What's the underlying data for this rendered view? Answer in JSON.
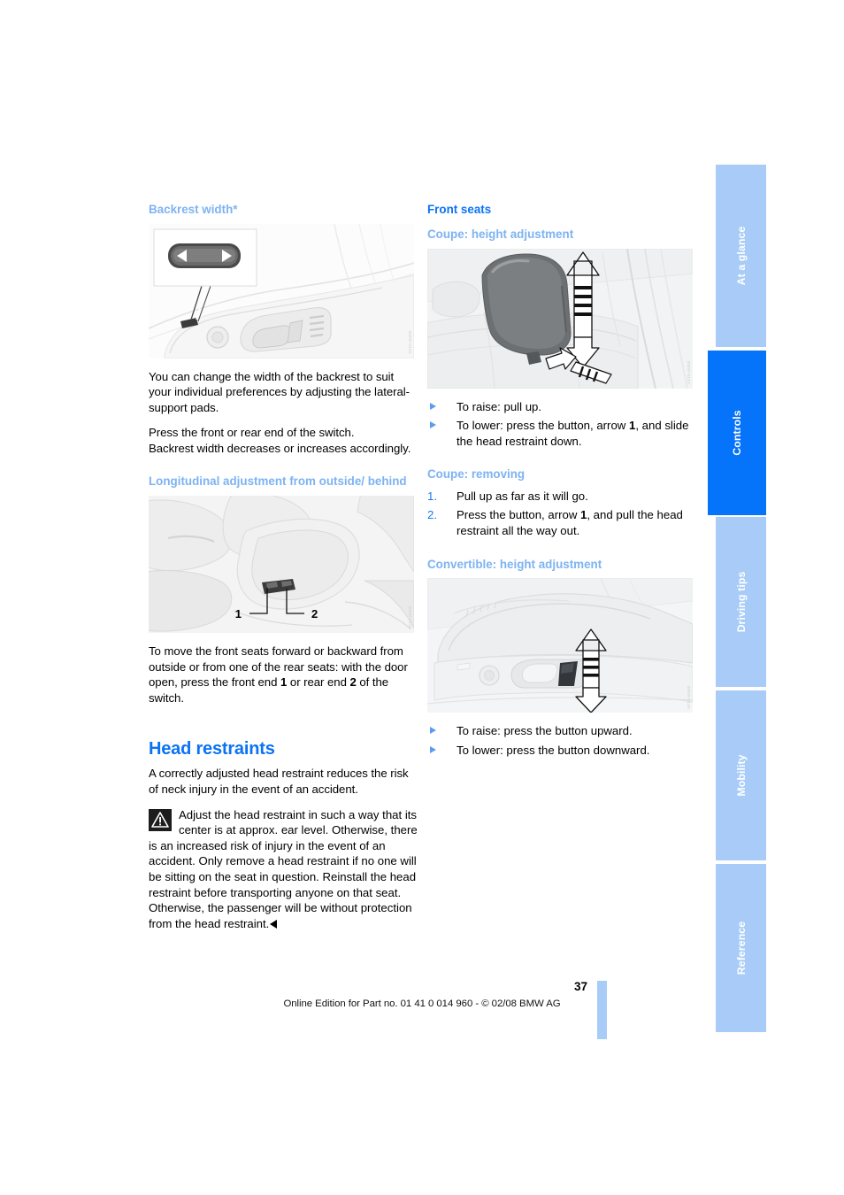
{
  "document": {
    "page_number": "37",
    "footer_text": "Online Edition for Part no. 01 41 0 014 960 - © 02/08 BMW AG"
  },
  "tabs": [
    {
      "label": "At a glance",
      "active": false
    },
    {
      "label": "Controls",
      "active": true
    },
    {
      "label": "Driving tips",
      "active": false
    },
    {
      "label": "Mobility",
      "active": false
    },
    {
      "label": "Reference",
      "active": false
    }
  ],
  "colors": {
    "heading_blue": "#0a72f5",
    "subheading_blue": "#7db3f2",
    "tab_inactive": "#a8ccf7",
    "tab_active": "#0673fb"
  },
  "left_column": {
    "backrest": {
      "heading": "Backrest width*",
      "figure_name": "seat-switch-backrest-width-illustration",
      "para1": "You can change the width of the backrest to suit your individual preferences by adjusting the lateral-support pads.",
      "para2_line1": "Press the front or rear end of the switch.",
      "para2_line2": "Backrest width decreases or increases accordingly."
    },
    "longitudinal": {
      "heading": "Longitudinal adjustment from outside/ behind",
      "figure_name": "rear-seat-release-switch-illustration",
      "figure_callout_1": "1",
      "figure_callout_2": "2",
      "para_part1": "To move the front seats forward or backward from outside or from one of the rear seats: with the door open, press the front end ",
      "para_bold1": "1",
      "para_part2": " or rear end ",
      "para_bold2": "2",
      "para_part3": " of the switch."
    },
    "head_restraints": {
      "heading": "Head restraints",
      "intro": "A correctly adjusted head restraint reduces the risk of neck injury in the event of an accident.",
      "warning": "Adjust the head restraint in such a way that its center is at approx. ear level. Otherwise, there is an increased risk of injury in the event of an accident. Only remove a head restraint if no one will be sitting on the seat in question. Reinstall the head restraint before transporting anyone on that seat. Otherwise, the passenger will be without protection from the head restraint."
    }
  },
  "right_column": {
    "front_seats": {
      "heading": "Front seats"
    },
    "coupe_height": {
      "heading": "Coupe: height adjustment",
      "figure_name": "coupe-head-restraint-height-illustration",
      "bullets": [
        {
          "text": "To raise: pull up."
        },
        {
          "part1": "To lower: press the button, arrow ",
          "bold": "1",
          "part2": ", and slide the head restraint down."
        }
      ]
    },
    "coupe_removing": {
      "heading": "Coupe: removing",
      "steps": [
        {
          "num": "1.",
          "text": "Pull up as far as it will go."
        },
        {
          "num": "2.",
          "part1": "Press the button, arrow ",
          "bold": "1",
          "part2": ", and pull the head restraint all the way out."
        }
      ]
    },
    "convertible_height": {
      "heading": "Convertible: height adjustment",
      "figure_name": "convertible-seat-switch-illustration",
      "bullets": [
        {
          "text": "To raise: press the button upward."
        },
        {
          "text": "To lower: press the button downward."
        }
      ]
    }
  }
}
